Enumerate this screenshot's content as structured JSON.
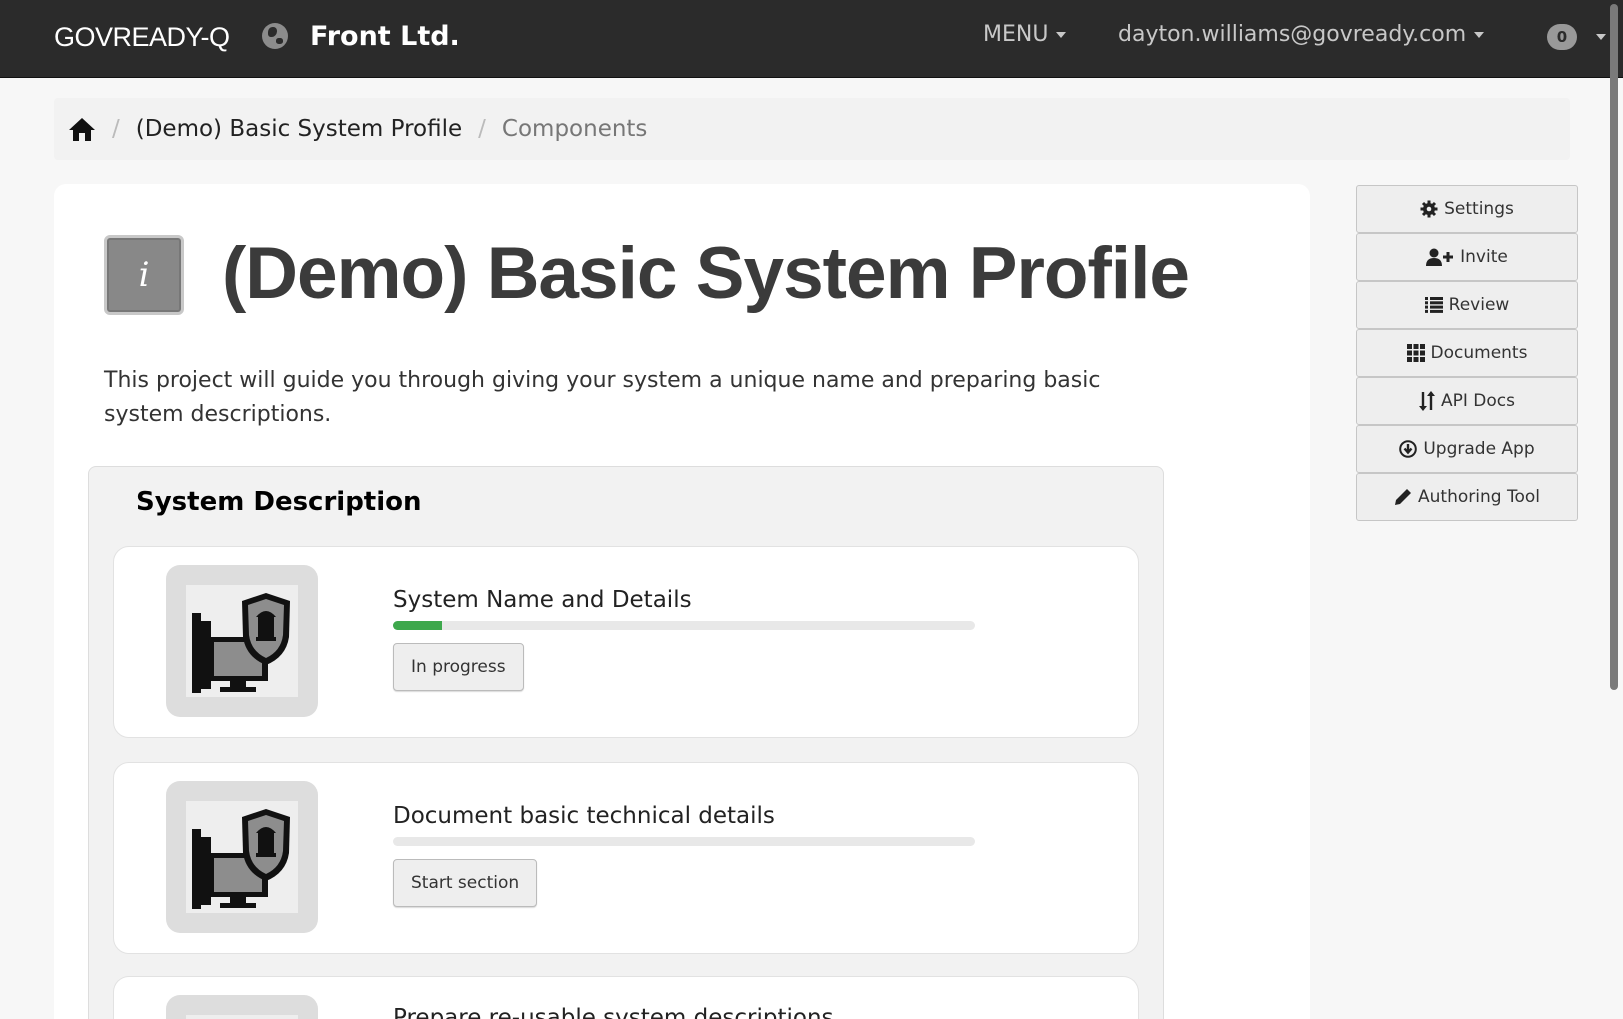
{
  "navbar": {
    "brand": "GOVREADY-Q",
    "org_name": "Front Ltd.",
    "menu_label": "MENU",
    "user_email": "dayton.williams@govready.com",
    "notification_count": "0"
  },
  "breadcrumb": {
    "items": [
      "(Demo) Basic System Profile"
    ],
    "current": "Components"
  },
  "page": {
    "icon_glyph": "i",
    "title": "(Demo) Basic System Profile",
    "description": "This project will guide you through giving your system a unique name and preparing basic system descriptions."
  },
  "section": {
    "title": "System Description",
    "tasks": [
      {
        "name": "System Name and Details",
        "progress": 0.085,
        "button_label": "In progress"
      },
      {
        "name": "Document basic technical details",
        "progress": 0,
        "button_label": "Start section"
      },
      {
        "name": "Prepare re-usable system descriptions",
        "progress": 0,
        "button_label": ""
      }
    ]
  },
  "sidebar": {
    "buttons": [
      {
        "label": "Settings",
        "icon": "gear-icon"
      },
      {
        "label": "Invite",
        "icon": "user-plus-icon"
      },
      {
        "label": "Review",
        "icon": "list-icon"
      },
      {
        "label": "Documents",
        "icon": "grid-icon"
      },
      {
        "label": "API Docs",
        "icon": "sort-icon"
      },
      {
        "label": "Upgrade App",
        "icon": "download-circle-icon"
      },
      {
        "label": "Authoring Tool",
        "icon": "pencil-icon"
      }
    ]
  },
  "colors": {
    "navbar_bg": "#2b2b2b",
    "progress_fill": "#3ea84c",
    "page_bg": "#f7f7f7"
  }
}
